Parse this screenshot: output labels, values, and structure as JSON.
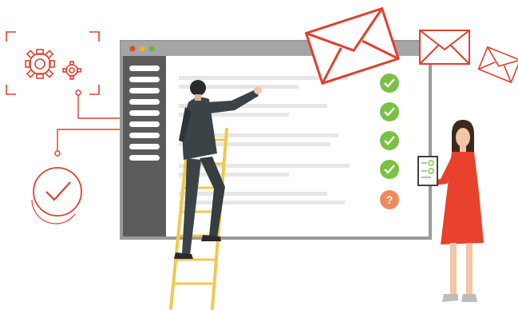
{
  "illustration": {
    "browser": {
      "dots": [
        "#e8412c",
        "#f4b324",
        "#5cb840"
      ],
      "sidebar_item_count": 7,
      "content_line_count": 12
    },
    "checklist": {
      "items": [
        {
          "status": "done",
          "icon": "check-icon"
        },
        {
          "status": "done",
          "icon": "check-icon"
        },
        {
          "status": "done",
          "icon": "check-icon"
        },
        {
          "status": "done",
          "icon": "check-icon"
        },
        {
          "status": "pending",
          "icon": "question-icon",
          "glyph": "?"
        }
      ]
    },
    "colors": {
      "accent_red": "#e0402f",
      "check_green": "#7ac143",
      "question_orange": "#f08a5d",
      "frame_gray": "#9a9a9a",
      "sidebar_gray": "#5b5b5b",
      "line_gray": "#e6e6e6",
      "ladder_yellow": "#f2c84b",
      "man_suit": "#3b4347",
      "woman_dress": "#e8412c"
    },
    "icons": [
      "gears-icon",
      "check-circle-icon",
      "envelope-icon",
      "ladder",
      "man-figure",
      "woman-figure",
      "clipboard-icon"
    ]
  }
}
